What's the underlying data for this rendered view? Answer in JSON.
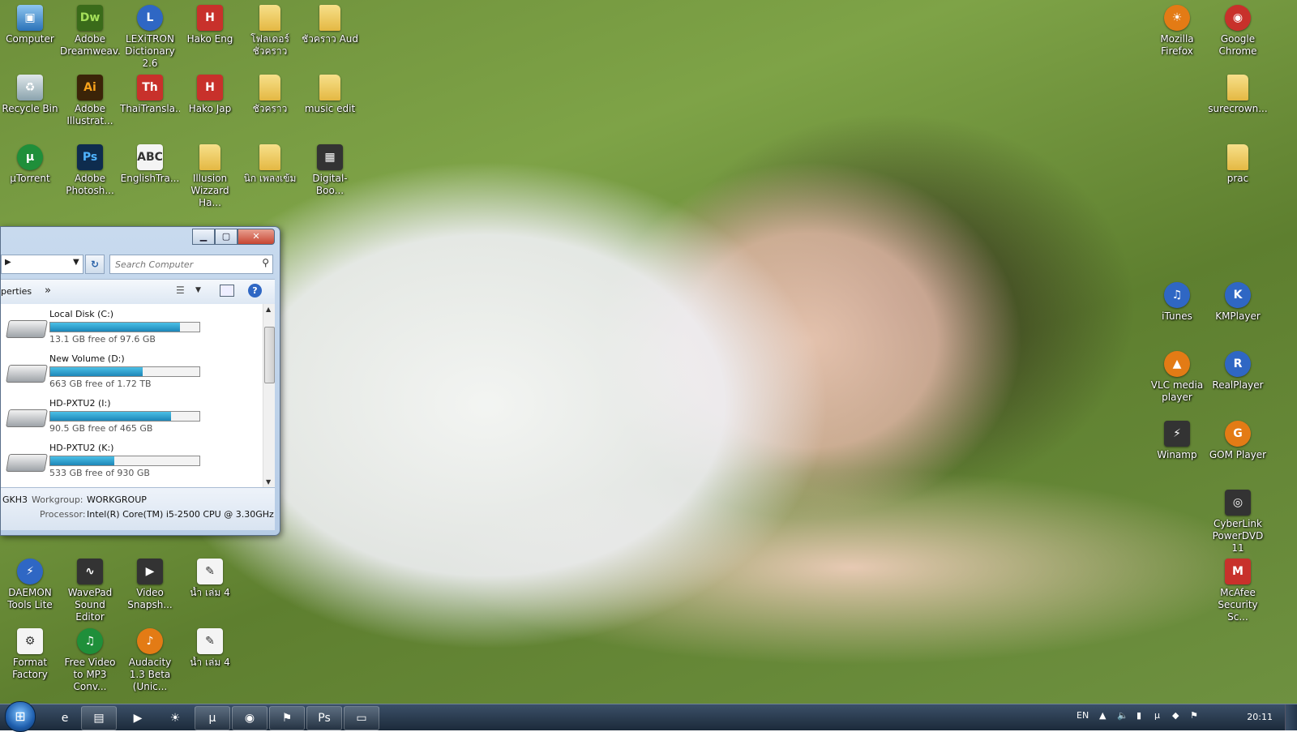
{
  "desktop_icons": {
    "computer": "Computer",
    "dreamweaver": "Adobe Dreamweav...",
    "lexitron": "LEXiTRON Dictionary 2.6",
    "hako_eng": "Hako Eng",
    "folder_thai1": "โฟลเดอร์ชั่วคราว",
    "folder_aud": "ชั่วคราว Aud",
    "firefox": "Mozilla Firefox",
    "chrome": "Google Chrome",
    "recycle_bin": "Recycle Bin",
    "illustrator": "Adobe Illustrat...",
    "thaitranslator": "ThaiTransla...",
    "hako_jap": "Hako Jap",
    "folder_thai2": "ชั่วคราว",
    "music_edit": "music edit",
    "surecrown": "surecrown...",
    "utorrent": "µTorrent",
    "photoshop": "Adobe Photosh...",
    "englishtra": "EnglishTra...",
    "illusion": "Illusion Wizzard Ha...",
    "folder_thai3": "นิก เพลงเข้ม",
    "digital_book": "Digital-Boo...",
    "prac": "prac",
    "itunes": "iTunes",
    "kmplayer": "KMPlayer",
    "vlc": "VLC media player",
    "realplayer": "RealPlayer",
    "winamp": "Winamp",
    "gom": "GOM Player",
    "powerdvd": "CyberLink PowerDVD 11",
    "daemon": "DAEMON Tools Lite",
    "wavepad": "WavePad Sound Editor",
    "video_snapshot": "Video Snapsh...",
    "nam_lem4_a": "น้ำ เล่ม 4",
    "mcafee": "McAfee Security Sc...",
    "format_factory": "Format Factory",
    "free_video": "Free Video to MP3 Conv...",
    "audacity": "Audacity 1.3 Beta (Unic...",
    "nam_lem4_b": "น้ำ เล่ม 4"
  },
  "explorer": {
    "search_placeholder": "Search Computer",
    "toolbar_properties": "perties",
    "toolbar_more": "»",
    "drives": [
      {
        "name": "Local Disk (C:)",
        "free_text": "13.1 GB free of 97.6 GB",
        "used_fraction": 0.87
      },
      {
        "name": "New Volume (D:)",
        "free_text": "663 GB free of 1.72 TB",
        "used_fraction": 0.62
      },
      {
        "name": "HD-PXTU2 (I:)",
        "free_text": "90.5 GB free of 465 GB",
        "used_fraction": 0.81
      },
      {
        "name": "HD-PXTU2 (K:)",
        "free_text": "533 GB free of 930 GB",
        "used_fraction": 0.43
      }
    ],
    "details": {
      "name": "GKH3",
      "workgroup_label": "Workgroup:",
      "workgroup_value": "WORKGROUP",
      "processor_label": "Processor:",
      "processor_value": "Intel(R) Core(TM) i5-2500 CPU @ 3.30GHz"
    }
  },
  "taskbar": {
    "language": "EN",
    "clock": "20:11"
  },
  "colors": {
    "taskbar": "#1c2a3a",
    "drive_bar": "#1d86b8",
    "window_frame": "#b6cce6"
  }
}
